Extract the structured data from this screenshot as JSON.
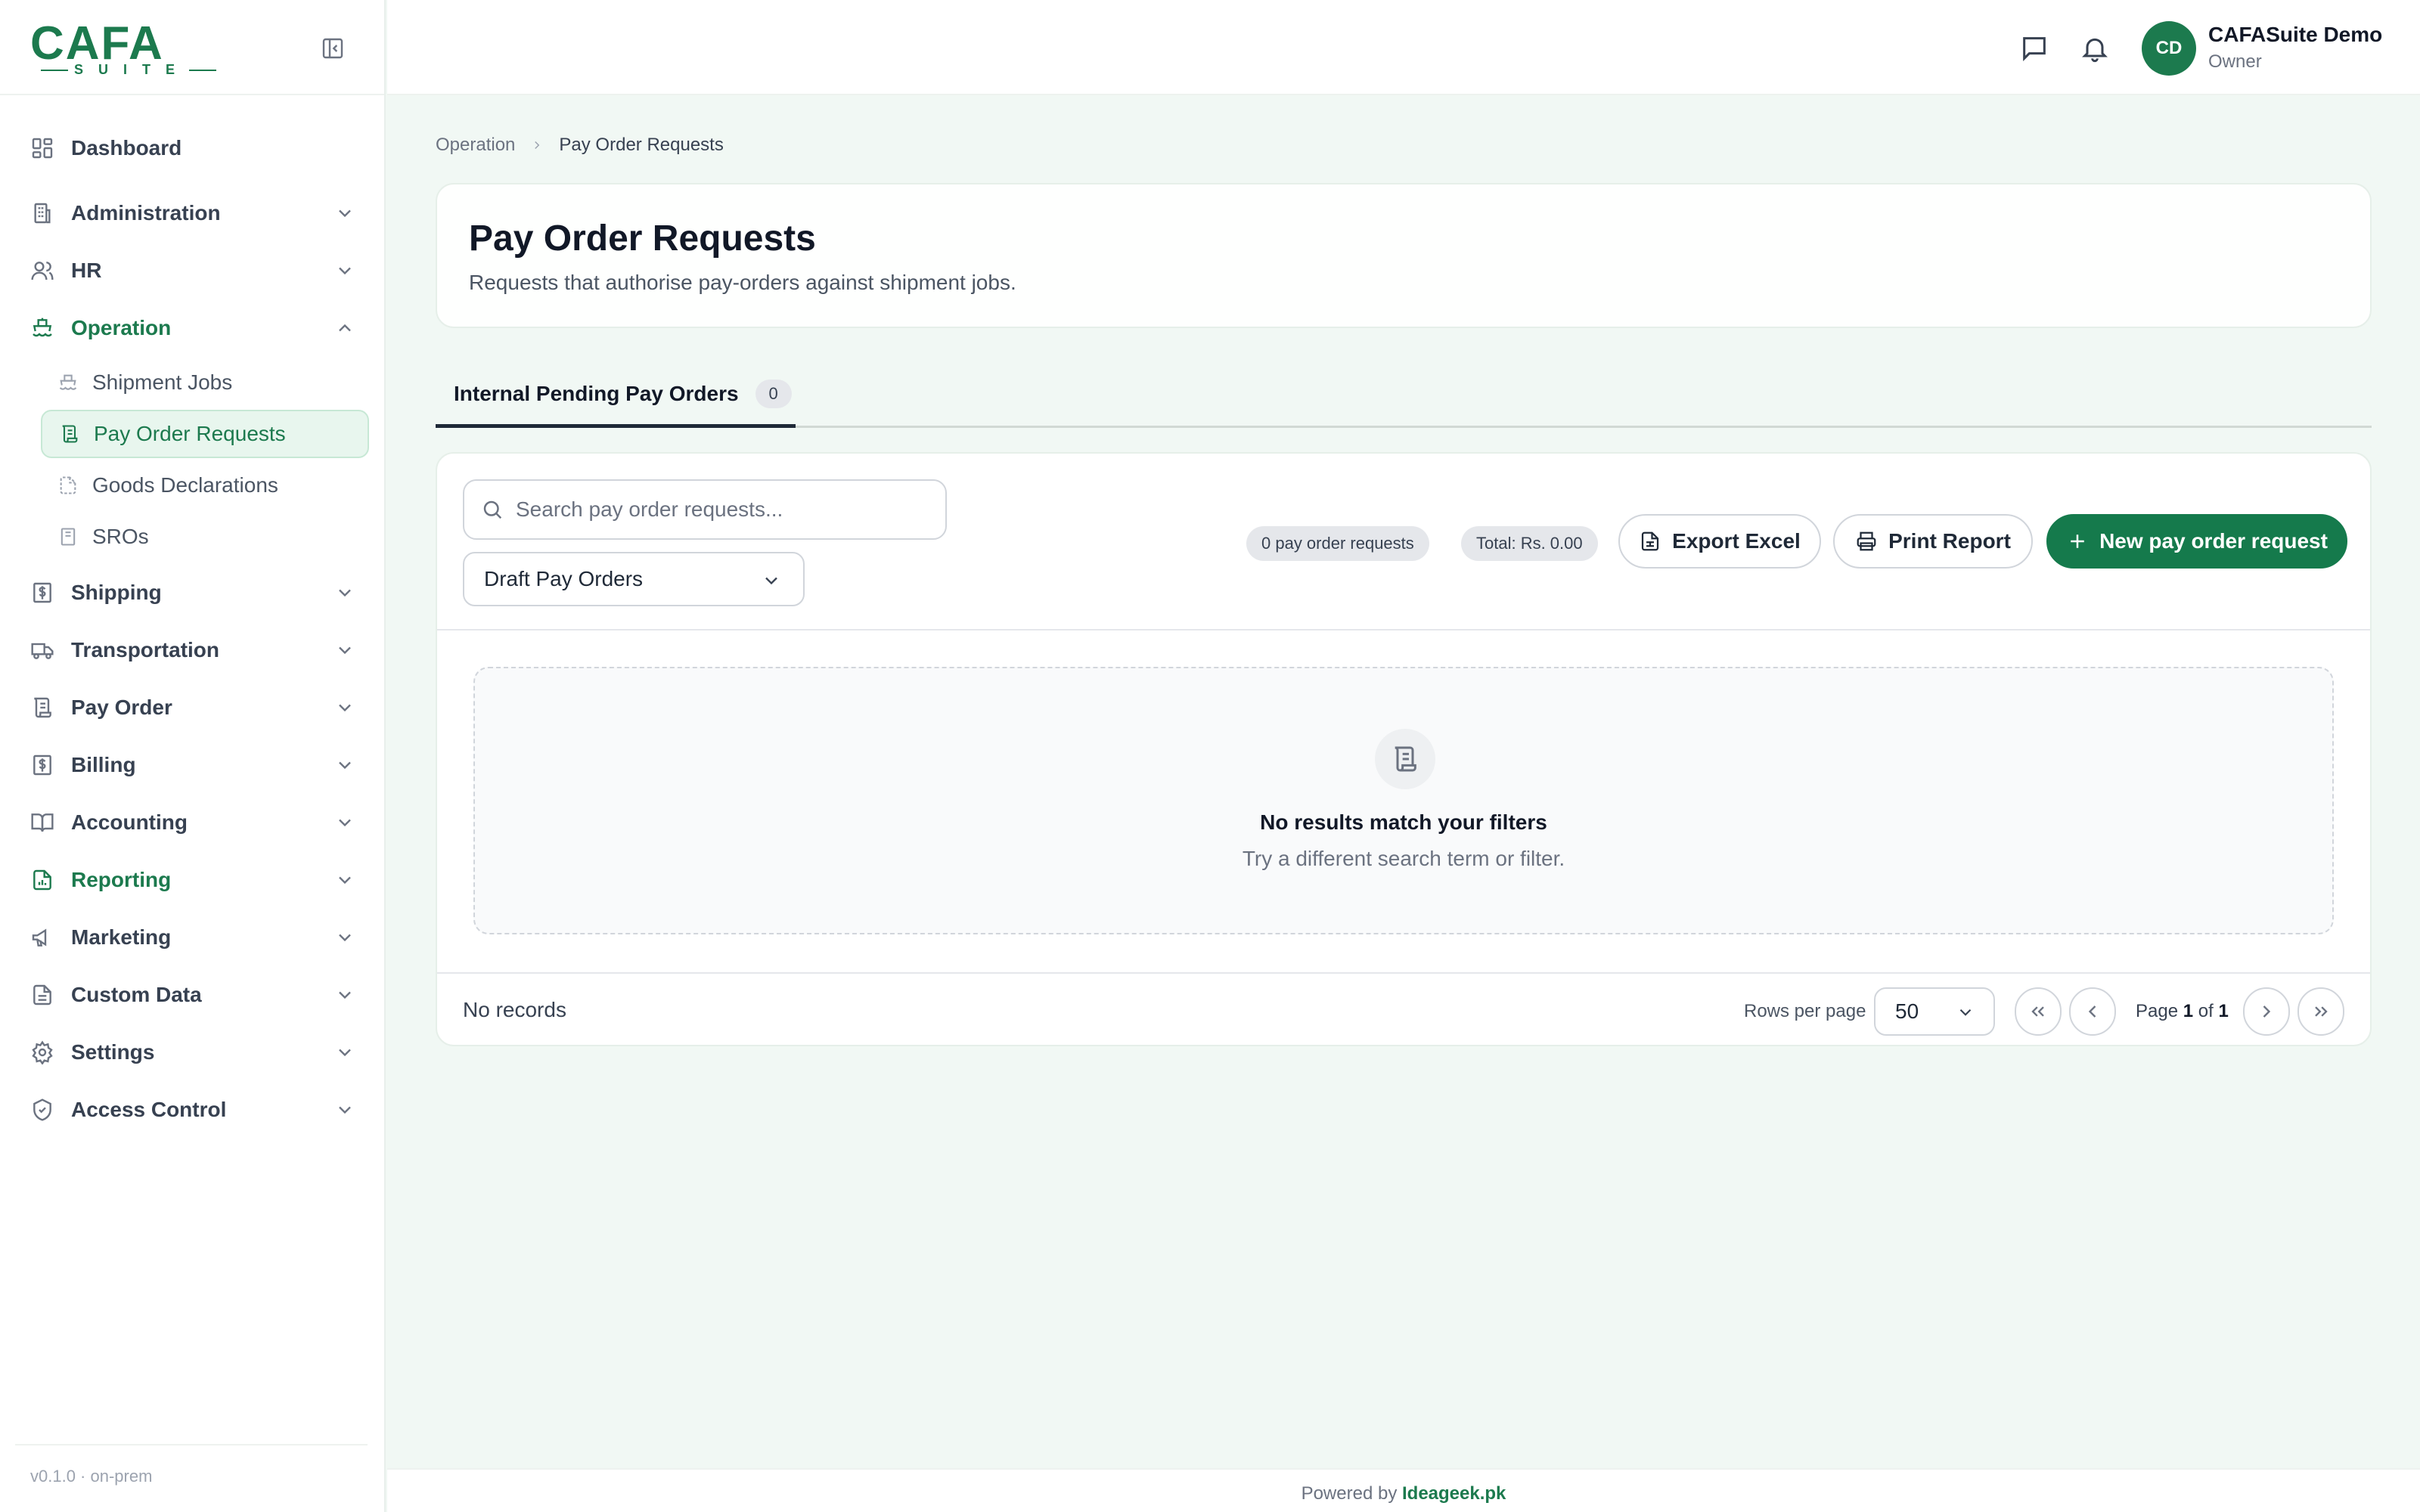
{
  "brand": {
    "logo_word": "CAFA",
    "logo_sub": "SUITE",
    "version": "v0.1.0 · on-prem",
    "accent": "#1c7a4e"
  },
  "sidebar": {
    "items": [
      {
        "label": "Dashboard",
        "icon": "dashboard-icon"
      },
      {
        "label": "Administration",
        "icon": "building-icon"
      },
      {
        "label": "HR",
        "icon": "users-icon"
      },
      {
        "label": "Operation",
        "icon": "ship-icon"
      },
      {
        "label": "Shipping",
        "icon": "receipt-icon"
      },
      {
        "label": "Transportation",
        "icon": "truck-icon"
      },
      {
        "label": "Pay Order",
        "icon": "scroll-icon"
      },
      {
        "label": "Billing",
        "icon": "billing-icon"
      },
      {
        "label": "Accounting",
        "icon": "book-icon"
      },
      {
        "label": "Reporting",
        "icon": "report-icon"
      },
      {
        "label": "Marketing",
        "icon": "megaphone-icon"
      },
      {
        "label": "Custom Data",
        "icon": "file-icon"
      },
      {
        "label": "Settings",
        "icon": "gear-icon"
      },
      {
        "label": "Access Control",
        "icon": "shield-icon"
      }
    ],
    "operation_sub": [
      {
        "label": "Shipment Jobs"
      },
      {
        "label": "Pay Order Requests"
      },
      {
        "label": "Goods Declarations"
      },
      {
        "label": "SROs"
      }
    ]
  },
  "header": {
    "avatar_initials": "CD",
    "user_name": "CAFASuite Demo",
    "user_role": "Owner"
  },
  "breadcrumb": {
    "parent": "Operation",
    "current": "Pay Order Requests"
  },
  "page": {
    "title": "Pay Order Requests",
    "subtitle": "Requests that authorise pay-orders against shipment jobs."
  },
  "tabs": [
    {
      "label": "Internal Pending Pay Orders",
      "count": "0"
    }
  ],
  "toolbar": {
    "search_placeholder": "Search pay order requests...",
    "filter_value": "Draft Pay Orders",
    "count_pill": "0 pay order requests",
    "total_pill": "Total: Rs. 0.00",
    "export_label": "Export Excel",
    "print_label": "Print Report",
    "new_label": "New pay order request"
  },
  "empty_state": {
    "title": "No results match your filters",
    "hint": "Try a different search term or filter."
  },
  "pagination": {
    "records_text": "No records",
    "rows_label": "Rows per page",
    "rows_value": "50",
    "page_prefix": "Page",
    "page_current": "1",
    "page_of": "of",
    "page_total": "1"
  },
  "footer": {
    "powered_by": "Powered by",
    "company": "Ideageek.pk"
  }
}
